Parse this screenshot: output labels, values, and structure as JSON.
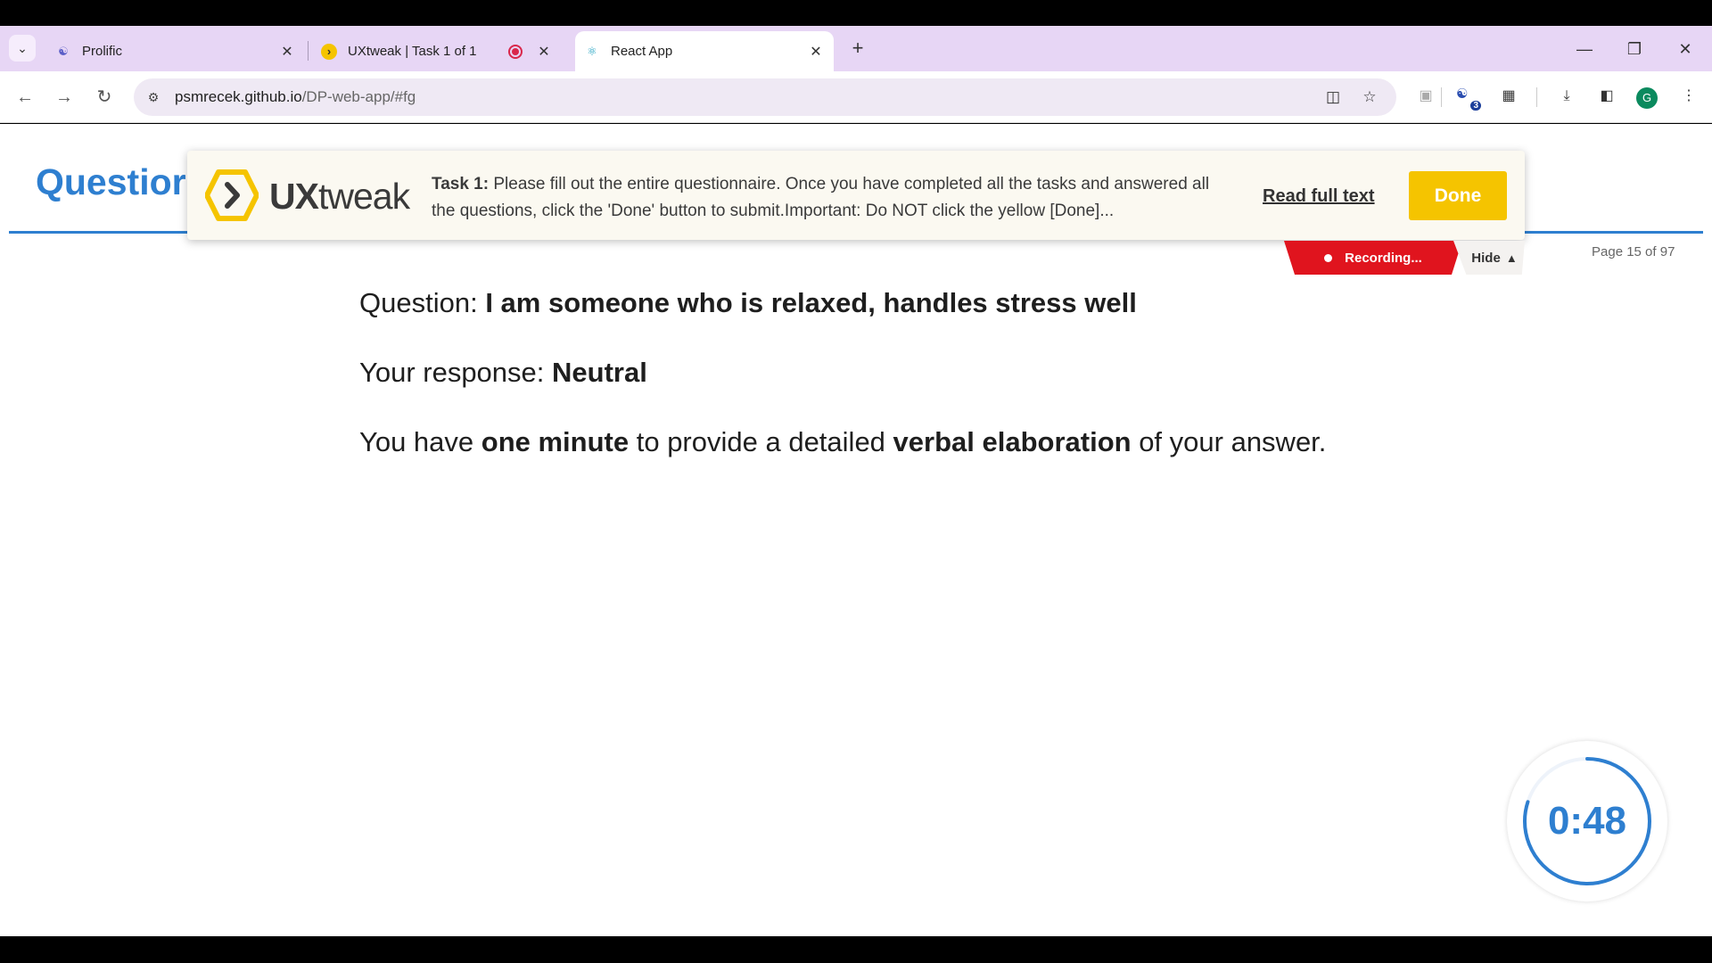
{
  "browser": {
    "tabs": [
      {
        "label": "Prolific",
        "icon": "prolific-icon"
      },
      {
        "label": "UXtweak | Task 1 of 1",
        "icon": "uxtweak-icon",
        "recording": true
      },
      {
        "label": "React App",
        "icon": "react-icon",
        "active": true
      }
    ],
    "url_host": "psmrecek.github.io",
    "url_path": "/DP-web-app/#fg",
    "extension_badge": "3",
    "profile_initial": "G"
  },
  "page": {
    "title": "Questior",
    "page_indicator": "Page 15 of 97",
    "question_prefix": "Question: ",
    "question_text": "I am someone who is relaxed, handles stress well",
    "response_prefix": "Your response: ",
    "response_value": "Neutral",
    "instruction_parts": [
      "You have ",
      "one minute",
      " to provide a detailed ",
      "verbal elaboration",
      " of your answer."
    ],
    "timer": "0:48",
    "timer_progress": 0.8
  },
  "uxtweak": {
    "logo_ux": "UX",
    "logo_tweak": "tweak",
    "task_label": "Task 1:",
    "task_text": " Please fill out the entire questionnaire. Once you have completed all the tasks and answered all the questions, click the 'Done' button to submit.Important: Do NOT click the yellow [Done]...",
    "read_full_text": "Read full text",
    "done_label": "Done",
    "recording_label": "Recording...",
    "hide_label": "Hide"
  },
  "colors": {
    "accent": "#2e7fd0",
    "done_button": "#f5c400",
    "recording": "#e0141e",
    "tabstrip": "#e7d6f5"
  }
}
